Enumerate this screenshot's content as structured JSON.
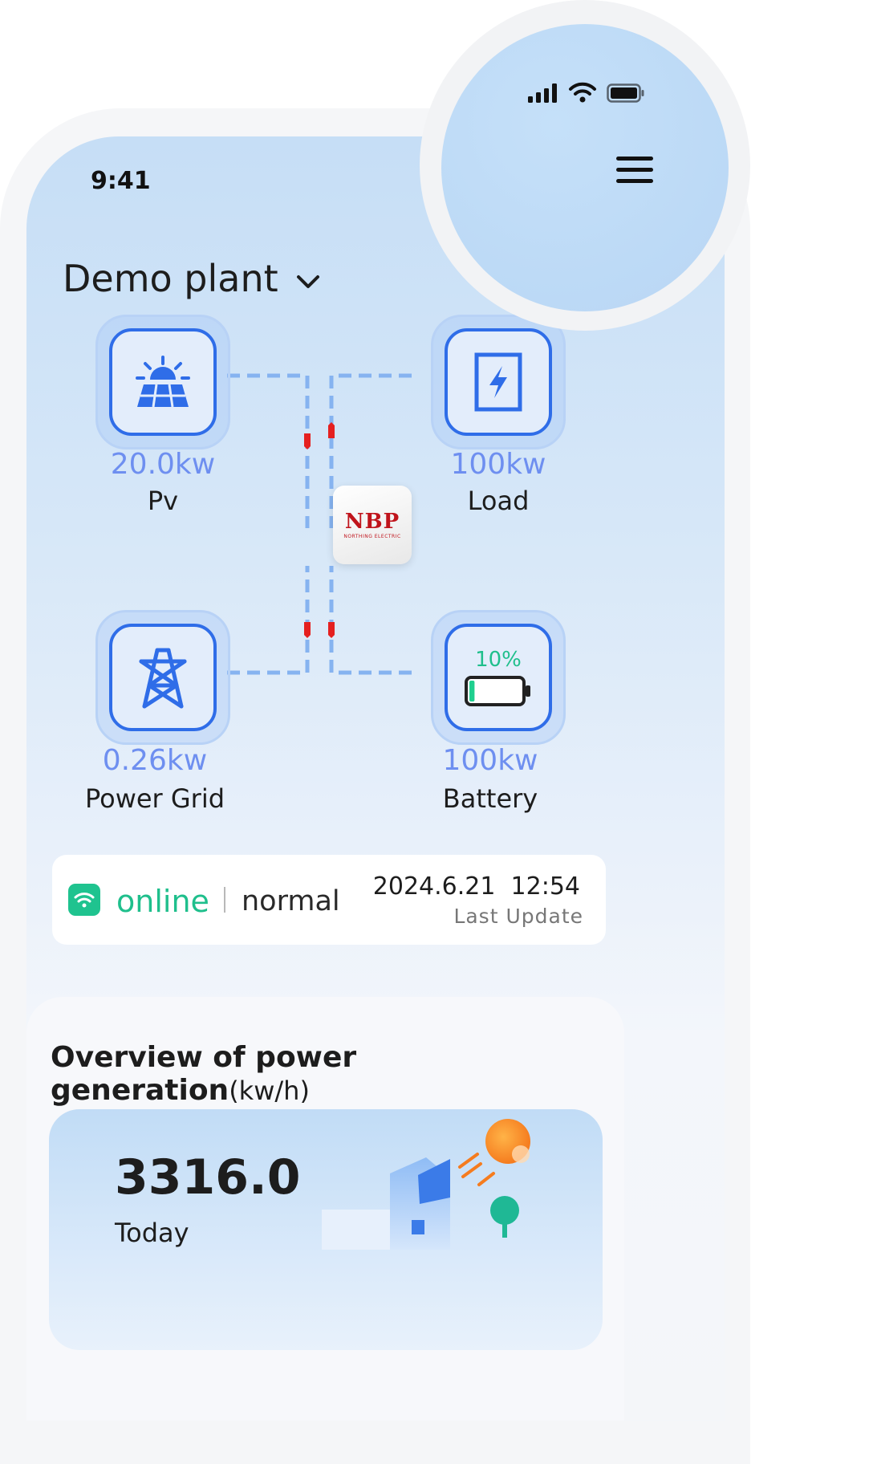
{
  "status_bar": {
    "time": "9:41"
  },
  "header": {
    "plant_name": "Demo plant"
  },
  "flow": {
    "pv": {
      "value": "20.0kw",
      "label": "Pv"
    },
    "load": {
      "value": "100kw",
      "label": "Load"
    },
    "grid": {
      "value": "0.26kw",
      "label": "Power Grid"
    },
    "battery": {
      "value": "100kw",
      "label": "Battery",
      "percent": "10%",
      "charge_level": 0.1
    },
    "inverter_logo": {
      "text": "NBP",
      "subtext": "NORTHING ELECTRIC"
    }
  },
  "status": {
    "connection": "online",
    "state": "normal",
    "datetime": "2024.6.21  12:54",
    "last_update_label": "Last Update"
  },
  "overview": {
    "title": "Overview of power generation",
    "unit": "(kw/h)",
    "today_value": "3316.0",
    "today_label": "Today"
  },
  "colors": {
    "accent": "#2f6de8",
    "value_text": "#6e8ff0",
    "online": "#1fbf8c",
    "flow_arrow": "#e52020"
  }
}
